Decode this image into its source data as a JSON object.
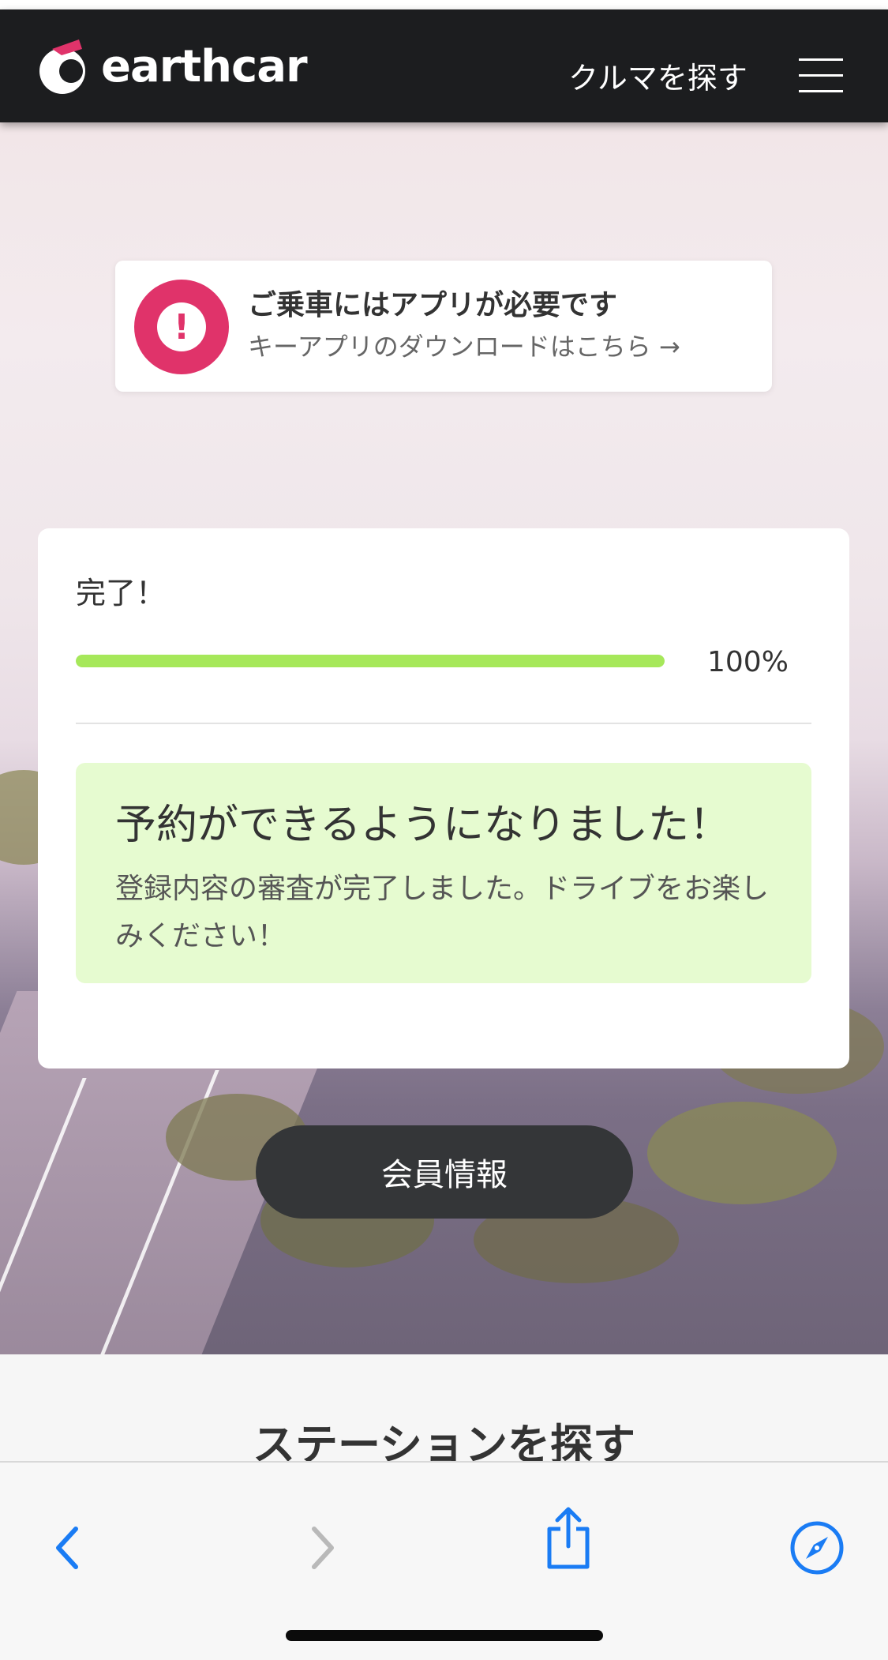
{
  "header": {
    "brand": "earthcar",
    "find_car": "クルマを探す",
    "menu_icon": "hamburger-menu-icon"
  },
  "notice": {
    "icon": "exclamation-icon",
    "title": "ご乗車にはアプリが必要です",
    "link": "キーアプリのダウンロードはこちら →"
  },
  "status": {
    "label": "完了！",
    "progress_percent": 100,
    "progress_text": "100%",
    "message_title": "予約ができるようになりました！",
    "message_body": "登録内容の審査が完了しました。ドライブをお楽しみください！"
  },
  "member_button": "会員情報",
  "section_title": "ステーションを探す",
  "toolbar": {
    "back_icon": "chevron-left-icon",
    "forward_icon": "chevron-right-icon",
    "share_icon": "share-icon",
    "safari_icon": "compass-icon"
  },
  "colors": {
    "accent_pink": "#e0336a",
    "progress_green": "#a6e85a",
    "success_bg": "#e6fbd0",
    "ios_blue": "#1a7cf4",
    "header_bg": "#1c1d1f"
  }
}
